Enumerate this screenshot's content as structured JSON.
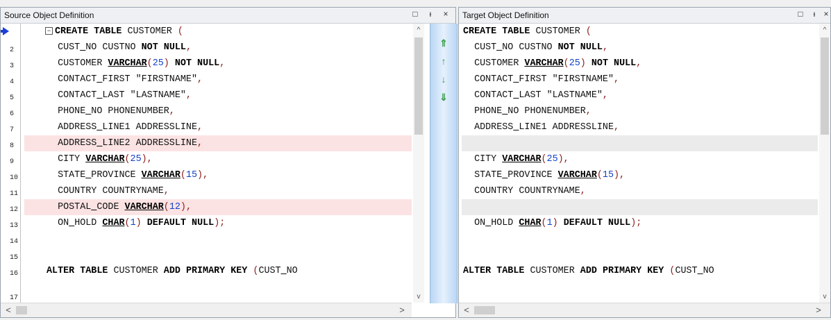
{
  "source": {
    "title": "Source Object Definition",
    "buttons": {
      "maximize": "□",
      "pin": "ᵻ",
      "close": "×"
    },
    "line_numbers": [
      "",
      "2",
      "3",
      "4",
      "5",
      "6",
      "7",
      "8",
      "9",
      "10",
      "11",
      "12",
      "13",
      "14",
      "15",
      "16",
      "17"
    ],
    "lines": [
      "CREATE TABLE CUSTOMER (",
      "  CUST_NO CUSTNO NOT NULL,",
      "  CUSTOMER VARCHAR(25) NOT NULL,",
      "  CONTACT_FIRST \"FIRSTNAME\",",
      "  CONTACT_LAST \"LASTNAME\",",
      "  PHONE_NO PHONENUMBER,",
      "  ADDRESS_LINE1 ADDRESSLINE,",
      "  ADDRESS_LINE2 ADDRESSLINE,",
      "  CITY VARCHAR(25),",
      "  STATE_PROVINCE VARCHAR(15),",
      "  COUNTRY COUNTRYNAME,",
      "  POSTAL_CODE VARCHAR(12),",
      "  ON_HOLD CHAR(1) DEFAULT NULL);",
      "",
      "",
      "ALTER TABLE CUSTOMER ADD PRIMARY KEY (CUST_NO"
    ],
    "fold_marker": "−"
  },
  "target": {
    "title": "Target Object Definition",
    "buttons": {
      "maximize": "□",
      "pin": "ᵻ",
      "close": "×"
    },
    "lines": [
      "CREATE TABLE CUSTOMER (",
      "  CUST_NO CUSTNO NOT NULL,",
      "  CUSTOMER VARCHAR(25) NOT NULL,",
      "  CONTACT_FIRST \"FIRSTNAME\",",
      "  CONTACT_LAST \"LASTNAME\",",
      "  PHONE_NO PHONENUMBER,",
      "  ADDRESS_LINE1 ADDRESSLINE,",
      "",
      "  CITY VARCHAR(25),",
      "  STATE_PROVINCE VARCHAR(15),",
      "  COUNTRY COUNTRYNAME,",
      "",
      "  ON_HOLD CHAR(1) DEFAULT NULL);",
      "",
      "",
      "ALTER TABLE CUSTOMER ADD PRIMARY KEY (CUST_NO"
    ]
  },
  "nav": {
    "first_diff": "⇑",
    "prev_diff": "↑",
    "next_diff": "↓",
    "last_diff": "⇓"
  },
  "diff": {
    "removed_color": "#fce3e3",
    "blank_color": "#ebebeb"
  }
}
